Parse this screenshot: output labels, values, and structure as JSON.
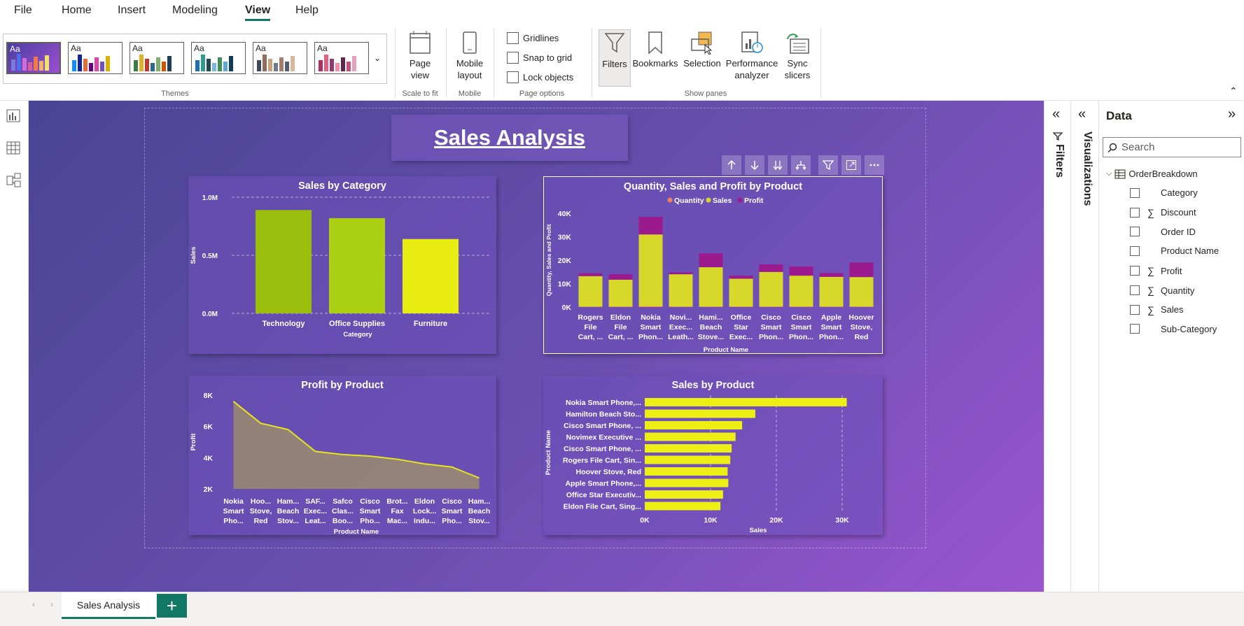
{
  "menu": [
    "File",
    "Home",
    "Insert",
    "Modeling",
    "View",
    "Help"
  ],
  "ribbon": {
    "groups": {
      "themes": "Themes",
      "scale": "Scale to fit",
      "mobile": "Mobile",
      "page_options": "Page options",
      "show_panes": "Show panes"
    },
    "theme_thumb_label": "Aa",
    "page_view": "Page view",
    "mobile_layout": [
      "Mobile",
      "layout"
    ],
    "options": [
      "Gridlines",
      "Snap to grid",
      "Lock objects"
    ],
    "panes": {
      "filters": "Filters",
      "bookmarks": "Bookmarks",
      "selection": "Selection",
      "perf": [
        "Performance",
        "analyzer"
      ],
      "sync": [
        "Sync",
        "slicers"
      ]
    }
  },
  "report": {
    "title": "Sales Analysis"
  },
  "charts": {
    "cat": {
      "title": "Sales by Category",
      "categories": [
        "Technology",
        "Office Supplies",
        "Furniture"
      ],
      "values": [
        0.89,
        0.82,
        0.64
      ],
      "ticks": [
        "1.0M",
        "0.5M",
        "0.0M"
      ],
      "xlabel": "Category",
      "ylabel": "Sales",
      "colors": [
        "#9bbe0d",
        "#abd014",
        "#e9ed12"
      ]
    },
    "qsp": {
      "title": "Quantity, Sales and Profit by Product",
      "legend": [
        "Quantity",
        "Sales",
        "Profit"
      ],
      "legend_colors": [
        "#f08060",
        "#d8d82a",
        "#9b1b8e"
      ],
      "categories": [
        [
          "Rogers",
          "File",
          "Cart, ..."
        ],
        [
          "Eldon",
          "File",
          "Cart, ..."
        ],
        [
          "Nokia",
          "Smart",
          "Phon..."
        ],
        [
          "Novi...",
          "Exec...",
          "Leath..."
        ],
        [
          "Hami...",
          "Beach",
          "Stove..."
        ],
        [
          "Office",
          "Star",
          "Exec..."
        ],
        [
          "Cisco",
          "Smart",
          "Phon..."
        ],
        [
          "Cisco",
          "Smart",
          "Phon..."
        ],
        [
          "Apple",
          "Smart",
          "Phon..."
        ],
        [
          "Hoover",
          "Stove,",
          "Red"
        ]
      ],
      "quantity": [
        0.2,
        0.2,
        0.3,
        0.2,
        0.2,
        0.2,
        0.2,
        0.2,
        0.2,
        0.2
      ],
      "sales": [
        13,
        11.5,
        30.7,
        13.8,
        16.8,
        11.9,
        14.8,
        13.2,
        12.7,
        12.6
      ],
      "profit": [
        1.2,
        2.3,
        7.5,
        0.8,
        5.9,
        1.3,
        3.2,
        3.9,
        1.6,
        6.2
      ],
      "ticks": [
        "40K",
        "30K",
        "20K",
        "10K",
        "0K"
      ],
      "xlabel": "Product Name",
      "ylabel": "Quantity, Sales and Profit"
    },
    "profit": {
      "title": "Profit by Product",
      "categories": [
        [
          "Nokia",
          "Smart",
          "Pho..."
        ],
        [
          "Hoo...",
          "Stove,",
          "Red"
        ],
        [
          "Ham...",
          "Beach",
          "Stov..."
        ],
        [
          "SAF...",
          "Exec...",
          "Leat..."
        ],
        [
          "Safco",
          "Clas...",
          "Boo..."
        ],
        [
          "Cisco",
          "Smart",
          "Pho..."
        ],
        [
          "Brot...",
          "Fax",
          "Mac..."
        ],
        [
          "Eldon",
          "Lock...",
          "Indu..."
        ],
        [
          "Cisco",
          "Smart",
          "Pho..."
        ],
        [
          "Ham...",
          "Beach",
          "Stov..."
        ]
      ],
      "values": [
        7.6,
        6.2,
        5.8,
        4.4,
        4.2,
        4.1,
        3.9,
        3.6,
        3.4,
        2.7
      ],
      "ticks": [
        "8K",
        "6K",
        "4K",
        "2K"
      ],
      "xlabel": "Product Name",
      "ylabel": "Profit"
    },
    "sales": {
      "title": "Sales by Product",
      "categories": [
        "Nokia Smart Phone,...",
        "Hamilton Beach Sto...",
        "Cisco Smart Phone, ...",
        "Novimex Executive ...",
        "Cisco Smart Phone, ...",
        "Rogers File Cart, Sin...",
        "Hoover Stove, Red",
        "Apple Smart Phone,...",
        "Office Star Executiv...",
        "Eldon File Cart, Sing..."
      ],
      "values": [
        30.7,
        16.8,
        14.8,
        13.8,
        13.2,
        13,
        12.6,
        12.7,
        11.9,
        11.5
      ],
      "ticks": [
        "0K",
        "10K",
        "20K",
        "30K"
      ],
      "xlabel": "Sales",
      "ylabel": "Product Name"
    }
  },
  "panes": {
    "filters": "Filters",
    "visualizations": "Visualizations"
  },
  "data_pane": {
    "title": "Data",
    "search_placeholder": "Search",
    "table": "OrderBreakdown",
    "fields": [
      {
        "name": "Category",
        "sigma": false
      },
      {
        "name": "Discount",
        "sigma": true
      },
      {
        "name": "Order ID",
        "sigma": false
      },
      {
        "name": "Product Name",
        "sigma": false
      },
      {
        "name": "Profit",
        "sigma": true
      },
      {
        "name": "Quantity",
        "sigma": true
      },
      {
        "name": "Sales",
        "sigma": true
      },
      {
        "name": "Sub-Category",
        "sigma": false
      }
    ]
  },
  "page_tabs": {
    "active": "Sales Analysis",
    "add": "+"
  },
  "chart_data": [
    {
      "type": "bar",
      "title": "Sales by Category",
      "categories": [
        "Technology",
        "Office Supplies",
        "Furniture"
      ],
      "values": [
        890000,
        820000,
        640000
      ],
      "xlabel": "Category",
      "ylabel": "Sales",
      "ylim": [
        0,
        1000000
      ]
    },
    {
      "type": "bar",
      "title": "Quantity, Sales and Profit by Product",
      "stacked": true,
      "categories": [
        "Rogers File Cart, ...",
        "Eldon File Cart, ...",
        "Nokia Smart Phon...",
        "Novi... Exec... Leath...",
        "Hami... Beach Stove...",
        "Office Star Exec...",
        "Cisco Smart Phon...",
        "Cisco Smart Phon...",
        "Apple Smart Phon...",
        "Hoover Stove, Red"
      ],
      "series": [
        {
          "name": "Quantity",
          "values": [
            200,
            200,
            300,
            200,
            200,
            200,
            200,
            200,
            200,
            200
          ]
        },
        {
          "name": "Sales",
          "values": [
            13000,
            11500,
            30700,
            13800,
            16800,
            11900,
            14800,
            13200,
            12700,
            12600
          ]
        },
        {
          "name": "Profit",
          "values": [
            1200,
            2300,
            7500,
            800,
            5900,
            1300,
            3200,
            3900,
            1600,
            6200
          ]
        }
      ],
      "xlabel": "Product Name",
      "ylabel": "Quantity, Sales and Profit",
      "ylim": [
        0,
        40000
      ]
    },
    {
      "type": "area",
      "title": "Profit by Product",
      "categories": [
        "Nokia Smart Pho...",
        "Hoo... Stove, Red",
        "Ham... Beach Stov...",
        "SAF... Exec... Leat...",
        "Safco Clas... Boo...",
        "Cisco Smart Pho...",
        "Brot... Fax Mac...",
        "Eldon Lock... Indu...",
        "Cisco Smart Pho...",
        "Ham... Beach Stov..."
      ],
      "values": [
        7600,
        6200,
        5800,
        4400,
        4200,
        4100,
        3900,
        3600,
        3400,
        2700
      ],
      "xlabel": "Product Name",
      "ylabel": "Profit",
      "ylim": [
        2000,
        8000
      ]
    },
    {
      "type": "bar",
      "orientation": "horizontal",
      "title": "Sales by Product",
      "categories": [
        "Nokia Smart Phone,...",
        "Hamilton Beach Sto...",
        "Cisco Smart Phone, ...",
        "Novimex Executive ...",
        "Cisco Smart Phone, ...",
        "Rogers File Cart, Sin...",
        "Hoover Stove, Red",
        "Apple Smart Phone,...",
        "Office Star Executiv...",
        "Eldon File Cart, Sing..."
      ],
      "values": [
        30700,
        16800,
        14800,
        13800,
        13200,
        13000,
        12600,
        12700,
        11900,
        11500
      ],
      "xlabel": "Sales",
      "ylabel": "Product Name",
      "xlim": [
        0,
        30000
      ]
    }
  ]
}
